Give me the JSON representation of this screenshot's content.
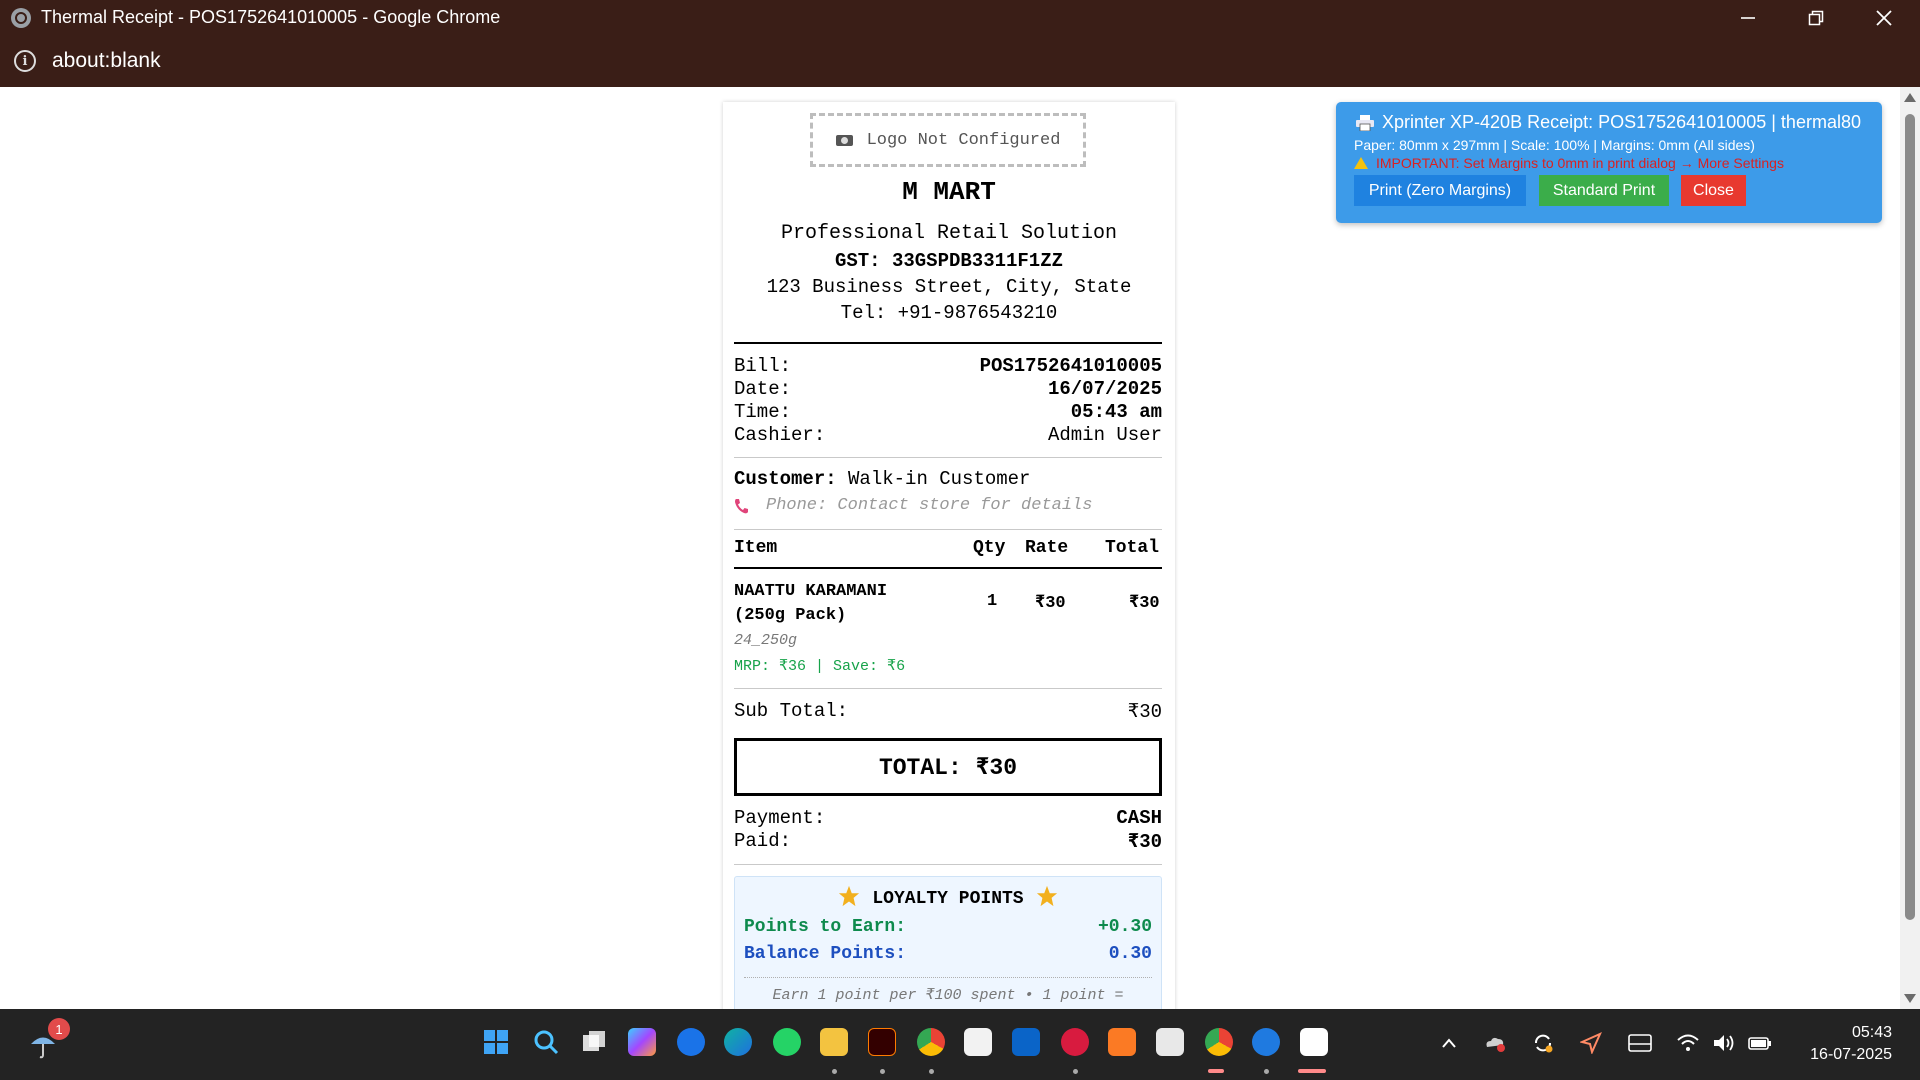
{
  "window": {
    "title": "Thermal Receipt - POS1752641010005 - Google Chrome",
    "url": "about:blank"
  },
  "receipt": {
    "logo_placeholder": "Logo Not Configured",
    "store_name": "M MART",
    "tagline": "Professional Retail Solution",
    "gst": "GST: 33GSPDB3311F1ZZ",
    "address": "123 Business Street, City, State",
    "tel": "Tel: +91-9876543210",
    "bill_label": "Bill:",
    "bill_value": "POS1752641010005",
    "date_label": "Date:",
    "date_value": "16/07/2025",
    "time_label": "Time:",
    "time_value": "05:43 am",
    "cashier_label": "Cashier:",
    "cashier_value": "Admin User",
    "customer_label": "Customer:",
    "customer_value": "Walk-in Customer",
    "phone_text": "Phone: Contact store for details",
    "columns": {
      "item": "Item",
      "qty": "Qty",
      "rate": "Rate",
      "total": "Total"
    },
    "items": [
      {
        "name": "NAATTU KARAMANI (250g Pack)",
        "qty": "1",
        "rate": "₹30",
        "total": "₹30",
        "sku": "24_250g",
        "mrp_save": "MRP: ₹36 | Save: ₹6"
      }
    ],
    "subtotal_label": "Sub Total:",
    "subtotal_value": "₹30",
    "grand_total": "TOTAL: ₹30",
    "payment_label": "Payment:",
    "payment_value": "CASH",
    "paid_label": "Paid:",
    "paid_value": "₹30",
    "loyalty": {
      "heading": "LOYALTY POINTS",
      "earn_label": "Points to Earn:",
      "earn_value": "+0.30",
      "balance_label": "Balance Points:",
      "balance_value": "0.30",
      "note": "Earn 1 point per ₹100 spent • 1 point ="
    }
  },
  "printer_panel": {
    "title": "Xprinter XP-420B Receipt: POS1752641010005 | thermal80",
    "details": "Paper: 80mm x 297mm | Scale: 100% | Margins: 0mm (All sides)",
    "warning": "IMPORTANT: Set Margins to 0mm in print dialog → More Settings",
    "btn_zero": "Print (Zero Margins)",
    "btn_standard": "Standard Print",
    "btn_close": "Close",
    "colors": {
      "panel": "#3d9be9",
      "zero": "#1f82e0",
      "standard": "#3bad4a",
      "close": "#e8392f",
      "warning": "#d92222"
    }
  },
  "taskbar": {
    "weather_badge": "1",
    "time": "05:43",
    "date": "16-07-2025",
    "apps": [
      "windows-start-icon",
      "search-icon",
      "task-view-icon",
      "copilot-icon",
      "app-store-icon",
      "edge-icon",
      "whatsapp-icon",
      "file-explorer-icon",
      "illustrator-icon",
      "chrome-icon",
      "microsoft-store-icon",
      "outlook-icon",
      "app-8-icon",
      "xampp-icon",
      "snipping-tool-icon",
      "chrome-profile-icon",
      "app-blue-icon",
      "capcut-icon"
    ]
  }
}
